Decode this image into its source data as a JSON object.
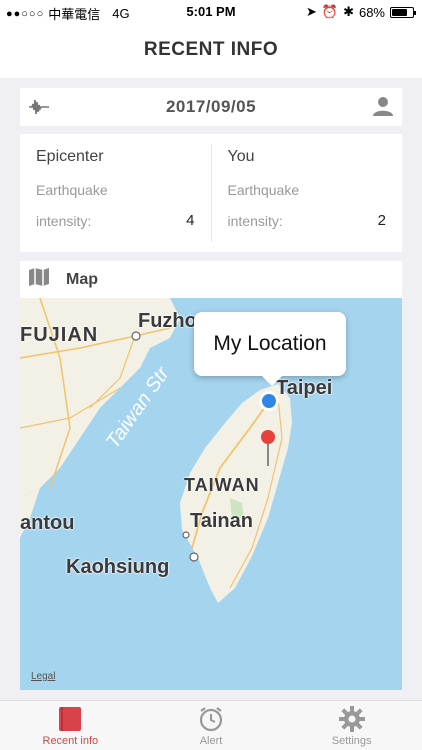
{
  "status_bar": {
    "carrier": "中華電信",
    "network": "4G",
    "time": "5:01 PM",
    "battery": "68%",
    "battery_level": 0.68
  },
  "nav": {
    "title": "RECENT INFO"
  },
  "date_card": {
    "date": "2017/09/05"
  },
  "info": {
    "epicenter": {
      "title": "Epicenter",
      "label1": "Earthquake",
      "label2": "intensity:",
      "value": "4"
    },
    "you": {
      "title": "You",
      "label1": "Earthquake",
      "label2": "intensity:",
      "value": "2"
    }
  },
  "map": {
    "header_label": "Map",
    "callout": "My Location",
    "legal": "Legal",
    "labels": {
      "fujian": "FUJIAN",
      "fuzhou": "Fuzhou",
      "taiwan_strait": "Taiwan Str",
      "taipei": "Taipei",
      "taiwan": "TAIWAN",
      "tainan": "Tainan",
      "shantou": "antou",
      "kaohsiung": "Kaohsiung"
    },
    "colors": {
      "water": "#a4d4ee",
      "land": "#f3f0e6",
      "user_dot": "#2f86e8",
      "pin": "#e8403a"
    }
  },
  "tabs": [
    {
      "label": "Recent info",
      "icon": "book-icon",
      "active": true
    },
    {
      "label": "Alert",
      "icon": "alarm-clock-icon",
      "active": false
    },
    {
      "label": "Settings",
      "icon": "gear-icon",
      "active": false
    }
  ]
}
